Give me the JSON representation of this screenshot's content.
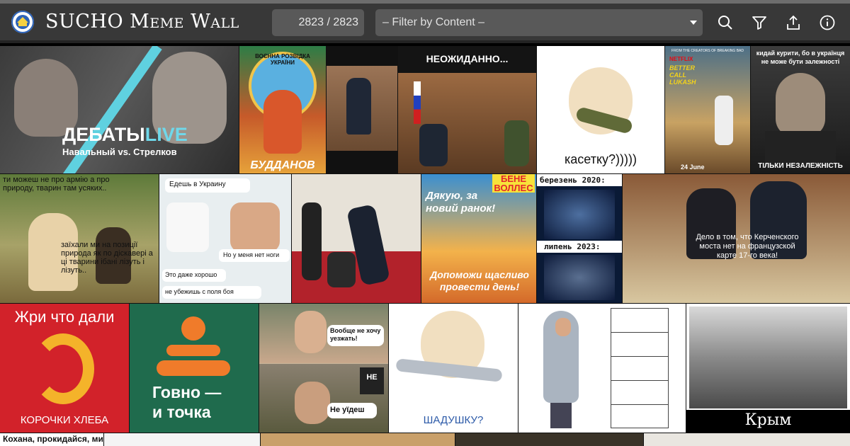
{
  "header": {
    "title": "SUCHO Meme Wall",
    "counter": "2823 / 2823",
    "filter_placeholder": "– Filter by Content –",
    "icons": [
      "logo-icon",
      "search-icon",
      "filter-icon",
      "share-icon",
      "info-icon"
    ]
  },
  "colors": {
    "header_bg": "#383838",
    "control_bg": "#595959",
    "text": "#ffffff"
  },
  "tiles": {
    "debaty": {
      "main": "ДЕБАТЫ",
      "accent": "LIVE",
      "sub": "Навальный vs. Стрелков"
    },
    "budanov": {
      "caption": "БУДДАНОВ",
      "ring": "ВОЄННА РОЗВІДКА УКРАЇНИ"
    },
    "neozhidanno": {
      "caption": "НЕОЖИДАННО..."
    },
    "kasetku": {
      "caption": "касетку?)))))"
    },
    "saul": {
      "top": "FROM THE CREATORS OF BREAKING BAD",
      "brand": "NETFLIX",
      "title": "BETTER CALL LUKASH",
      "date": "24 June"
    },
    "bandera": {
      "top": "кидай курити, бо в українця не може бути залежності",
      "bottom": "ТІЛЬКИ НЕЗАЛЕЖНІСТЬ"
    },
    "painting": {
      "top": "ти можеш не про армію а про природу, тварин там усяких..",
      "bottom": "заїхали ми на позиції природа як по діскавері а ці тварини ібані лізуть і лізуть.."
    },
    "doctor": {
      "line1": "Едешь в Украину",
      "line2": "Но у меня нет ноги",
      "line3": "Это даже хорошо",
      "line4": "не убежишь с поля боя"
    },
    "bene": {
      "logo": "БЕНЕ ВОЛЛЕС",
      "top": "Дякую, за новий ранок!",
      "bottom": "Допоможи щасливо провести день!"
    },
    "berezen": {
      "top": "березень 2020:",
      "mid": "липень 2023:"
    },
    "kerch": {
      "caption": "Дело в том, что Керченского моста нет на французской карте 17-го века!"
    },
    "zhri": {
      "top": "Жри что дали",
      "bottom": "КОРОЧКИ ХЛЕБА"
    },
    "govno": {
      "line1": "Говно —",
      "line2": "и точка"
    },
    "zaluzhny": {
      "bubble1": "Вообще не хочу уезжать!",
      "sign": "НЕ",
      "bubble2": "Не уїдеш"
    },
    "shadushku": {
      "caption": "ШАДУШКУ?"
    },
    "krym": {
      "caption": "Крым"
    },
    "bottom_row": {
      "caption": "Кохана, прокидайся, ми"
    }
  }
}
